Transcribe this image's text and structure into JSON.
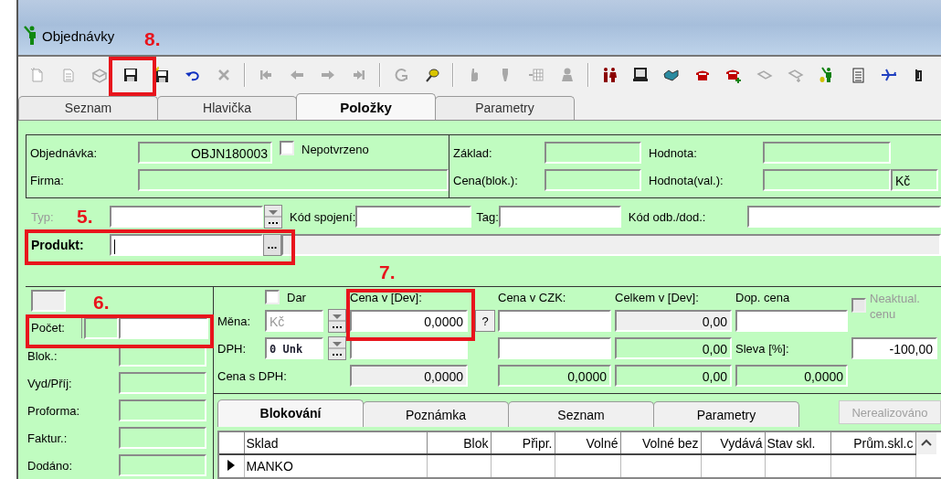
{
  "window": {
    "title": "Objednávky"
  },
  "annotations": [
    {
      "text": "8."
    },
    {
      "text": "5."
    },
    {
      "text": "6."
    },
    {
      "text": "7."
    }
  ],
  "toolbar": [
    {
      "kind": "button",
      "disabled": true
    },
    {
      "kind": "button",
      "disabled": true
    },
    {
      "kind": "button",
      "disabled": true
    },
    {
      "kind": "button",
      "disabled": false
    },
    {
      "kind": "button",
      "disabled": false
    },
    {
      "kind": "button",
      "disabled": false
    },
    {
      "kind": "button",
      "disabled": true
    },
    {
      "kind": "separator"
    },
    {
      "kind": "button",
      "disabled": true
    },
    {
      "kind": "button",
      "disabled": true
    },
    {
      "kind": "button",
      "disabled": true
    },
    {
      "kind": "button",
      "disabled": true
    },
    {
      "kind": "separator"
    },
    {
      "kind": "button",
      "disabled": true
    },
    {
      "kind": "button",
      "disabled": false
    },
    {
      "kind": "separator"
    },
    {
      "kind": "button",
      "disabled": true
    },
    {
      "kind": "button",
      "disabled": true
    },
    {
      "kind": "button",
      "disabled": true
    },
    {
      "kind": "button",
      "disabled": true
    },
    {
      "kind": "separator"
    },
    {
      "kind": "button",
      "disabled": false
    },
    {
      "kind": "button",
      "disabled": false
    },
    {
      "kind": "button",
      "disabled": false
    },
    {
      "kind": "button",
      "disabled": false
    },
    {
      "kind": "button",
      "disabled": false
    },
    {
      "kind": "button",
      "disabled": true
    },
    {
      "kind": "button",
      "disabled": true
    },
    {
      "kind": "button",
      "disabled": false
    },
    {
      "kind": "button",
      "disabled": false
    },
    {
      "kind": "button",
      "disabled": false
    },
    {
      "kind": "button",
      "disabled": false
    }
  ],
  "tabs": [
    {
      "label": "Seznam",
      "selected": false
    },
    {
      "label": "Hlavička",
      "selected": false
    },
    {
      "label": "Položky",
      "selected": true
    },
    {
      "label": "Parametry",
      "selected": false
    }
  ],
  "header": {
    "order": {
      "label": "Objednávka:",
      "value": "OBJN180003"
    },
    "unconfirmed": {
      "label": "Nepotvrzeno",
      "checked": false
    },
    "company": {
      "label": "Firma:"
    },
    "base": {
      "label": "Základ:"
    },
    "value": {
      "label": "Hodnota:"
    },
    "blocked_price": {
      "label": "Cena(blok.):"
    },
    "value_currency": {
      "label": "Hodnota(val.):",
      "currency": "Kč"
    }
  },
  "links": {
    "type": {
      "label": "Typ:",
      "disabled": true
    },
    "link_code": {
      "label": "Kód spojení:"
    },
    "tag": {
      "label": "Tag:"
    },
    "partner_code": {
      "label": "Kód odb./dod.:"
    }
  },
  "product": {
    "label": "Produkt:",
    "browse": "..."
  },
  "quantities": [
    {
      "label": "Počet:",
      "kind": "counter"
    },
    {
      "label": "Blok.:",
      "kind": "readonly"
    },
    {
      "label": "Vyd/Příj:",
      "kind": "readonly"
    },
    {
      "label": "Proforma:",
      "kind": "readonly"
    },
    {
      "label": "Faktur.:",
      "kind": "readonly"
    },
    {
      "label": "Dodáno:",
      "kind": "readonly"
    }
  ],
  "pricing": {
    "gift": {
      "label": "Dar",
      "checked": false
    },
    "currency": {
      "label": "Měna:",
      "value": "Kč",
      "disabled": true
    },
    "vat": {
      "label": "DPH:",
      "value": "0 Unk"
    },
    "price_with_vat": {
      "label": "Cena s DPH:"
    },
    "help": "?",
    "columns": [
      {
        "label": "Cena v [Dev]:",
        "cells": [
          {
            "kind": "input",
            "value": "0,0000"
          },
          {
            "kind": "input"
          },
          {
            "kind": "computed",
            "value": "0,0000"
          }
        ]
      },
      {
        "label": "Cena v CZK:",
        "cells": [
          {
            "kind": "input"
          },
          {
            "kind": "input"
          },
          {
            "kind": "readonly",
            "value": "0,0000"
          }
        ]
      },
      {
        "label": "Celkem v [Dev]:",
        "cells": [
          {
            "kind": "computed",
            "value": "0,00"
          },
          {
            "kind": "readonly",
            "value": "0,00"
          },
          {
            "kind": "readonly",
            "value": "0,00"
          }
        ]
      },
      {
        "label": "Dop. cena",
        "cells": [
          {
            "kind": "input"
          },
          {
            "kind": "label",
            "value": "Sleva [%]:"
          },
          {
            "kind": "readonly",
            "value": "0,0000"
          }
        ]
      }
    ],
    "stale": {
      "label": "Neaktual. cenu",
      "checked": false,
      "disabled": true
    },
    "discount": {
      "value": "-100,00"
    }
  },
  "subtabs": [
    {
      "label": "Blokování",
      "selected": true
    },
    {
      "label": "Poznámka",
      "selected": false
    },
    {
      "label": "Seznam",
      "selected": false
    },
    {
      "label": "Parametry",
      "selected": false
    }
  ],
  "unrealized_button": {
    "label": "Nerealizováno",
    "disabled": true
  },
  "table": {
    "columns": [
      "Sklad",
      "Blok",
      "Připr.",
      "Volné",
      "Volné bez",
      "Vydává",
      "Stav skl.",
      "Prům.skl.c"
    ],
    "rows": [
      {
        "current": true,
        "cells": [
          "MANKO"
        ]
      }
    ]
  }
}
